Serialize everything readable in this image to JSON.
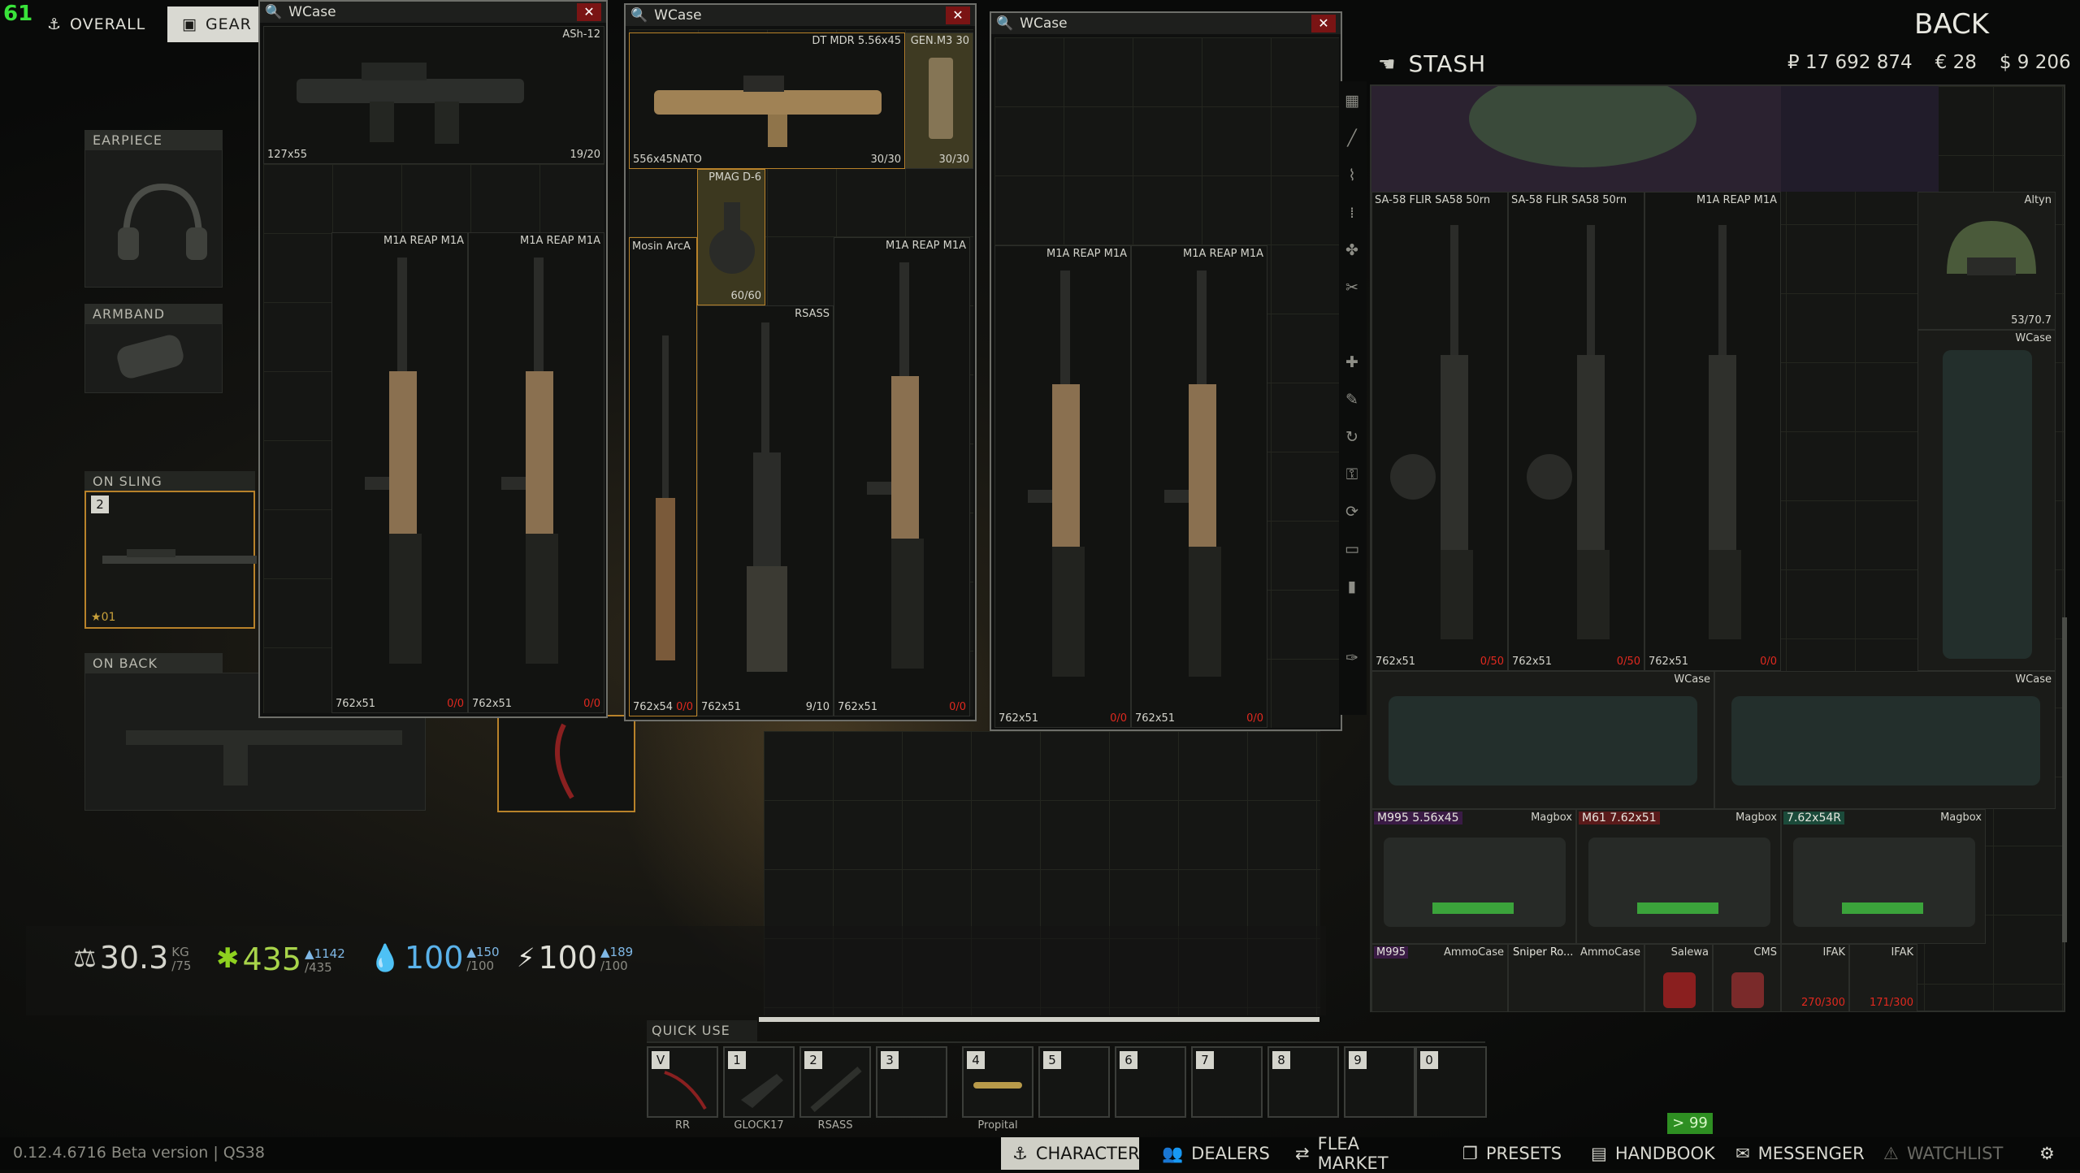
{
  "hud": {
    "fps": "61"
  },
  "top_tabs": {
    "overall": "OVERALL",
    "gear": "GEAR"
  },
  "back_label": "BACK",
  "slots": {
    "earpiece": "EARPIECE",
    "armband": "ARMBAND",
    "on_sling": "ON SLING",
    "on_sling_key": "2",
    "on_sling_count": "01",
    "on_back": "ON BACK"
  },
  "windows": [
    {
      "title": "WCase",
      "items": [
        {
          "name": "ASh-12",
          "caliber": "127x55",
          "ammo": "19/20"
        },
        {
          "name": "M1A REAP M1A",
          "caliber": "762x51",
          "ammo": "0/0"
        },
        {
          "name": "M1A REAP M1A",
          "caliber": "762x51",
          "ammo": "0/0"
        }
      ]
    },
    {
      "title": "WCase",
      "items": [
        {
          "name": "DT MDR 5.56x45",
          "caliber": "556x45NATO",
          "ammo": "30/30"
        },
        {
          "name": "GEN.M3 30",
          "caliber": "",
          "ammo": "30/30"
        },
        {
          "name": "PMAG D-6",
          "caliber": "",
          "ammo": "60/60"
        },
        {
          "name": "Mosin ArcA",
          "caliber": "762x54",
          "ammo": "0/0"
        },
        {
          "name": "RSASS",
          "caliber": "762x51",
          "ammo": "9/10"
        },
        {
          "name": "M1A REAP M1A",
          "caliber": "762x51",
          "ammo": "0/0"
        }
      ]
    },
    {
      "title": "WCase",
      "items": [
        {
          "name": "M1A REAP M1A",
          "caliber": "762x51",
          "ammo": "0/0"
        },
        {
          "name": "M1A REAP M1A",
          "caliber": "762x51",
          "ammo": "0/0"
        }
      ]
    }
  ],
  "stash": {
    "title": "STASH",
    "money": {
      "rub": "₽ 17 692 874",
      "eur": "€ 28",
      "usd": "$ 9 206"
    },
    "weapons": [
      {
        "name": "SA-58 FLIR SA58 50rn",
        "caliber": "762x51",
        "ammo": "0/50"
      },
      {
        "name": "SA-58 FLIR SA58 50rn",
        "caliber": "762x51",
        "ammo": "0/50"
      },
      {
        "name": "M1A REAP M1A",
        "caliber": "762x51",
        "ammo": "0/0"
      }
    ],
    "helmet": {
      "name": "Altyn",
      "durability": "53/70.7"
    },
    "side_case": "WCase",
    "cases": [
      {
        "name": "WCase"
      },
      {
        "name": "WCase"
      }
    ],
    "magboxes": [
      {
        "tag": "M995 5.56x45",
        "name": "Magbox"
      },
      {
        "tag": "M61 7.62x51",
        "name": "Magbox"
      },
      {
        "tag": "7.62x54R",
        "name": "Magbox"
      }
    ],
    "bottom_row": [
      {
        "tag": "M995",
        "name": "AmmoCase"
      },
      {
        "tag": "Sniper Ro...",
        "name": "AmmoCase"
      },
      {
        "tag": "",
        "name": "Salewa"
      },
      {
        "tag": "",
        "name": "CMS"
      },
      {
        "tag": "",
        "name": "IFAK",
        "value": "270/300"
      },
      {
        "tag": "",
        "name": "IFAK",
        "value": "171/300"
      }
    ]
  },
  "stats": {
    "weight": {
      "value": "30.3",
      "unit": "KG",
      "max": "/75"
    },
    "health": {
      "value": "435",
      "delta": "▲1142",
      "max": "/435"
    },
    "hydration": {
      "value": "100",
      "delta": "▲150",
      "max": "/100"
    },
    "energy": {
      "value": "100",
      "delta": "▲189",
      "max": "/100"
    }
  },
  "quick_use": {
    "title": "QUICK USE",
    "slots": [
      {
        "key": "V",
        "label": "RR"
      },
      {
        "key": "1",
        "label": "GLOCK17"
      },
      {
        "key": "2",
        "label": "RSASS"
      },
      {
        "key": "3",
        "label": ""
      },
      {
        "key": "4",
        "label": "Propital"
      },
      {
        "key": "5",
        "label": ""
      },
      {
        "key": "6",
        "label": ""
      },
      {
        "key": "7",
        "label": ""
      },
      {
        "key": "8",
        "label": ""
      },
      {
        "key": "9",
        "label": ""
      },
      {
        "key": "0",
        "label": ""
      }
    ]
  },
  "notification_badge": "> 99",
  "version": "0.12.4.6716 Beta version | QS38",
  "nav": {
    "character": "CHARACTER",
    "dealers": "DEALERS",
    "flea_market": "FLEA MARKET",
    "presets": "PRESETS",
    "handbook": "HANDBOOK",
    "messenger": "MESSENGER",
    "watchlist": "WATCHLIST"
  },
  "colors": {
    "accent_green": "#39e33a",
    "active_tab": "#d9d9d2",
    "close_red": "#7a1414",
    "empty_ammo": "#e0291f",
    "gold_outline": "#b8822a"
  }
}
